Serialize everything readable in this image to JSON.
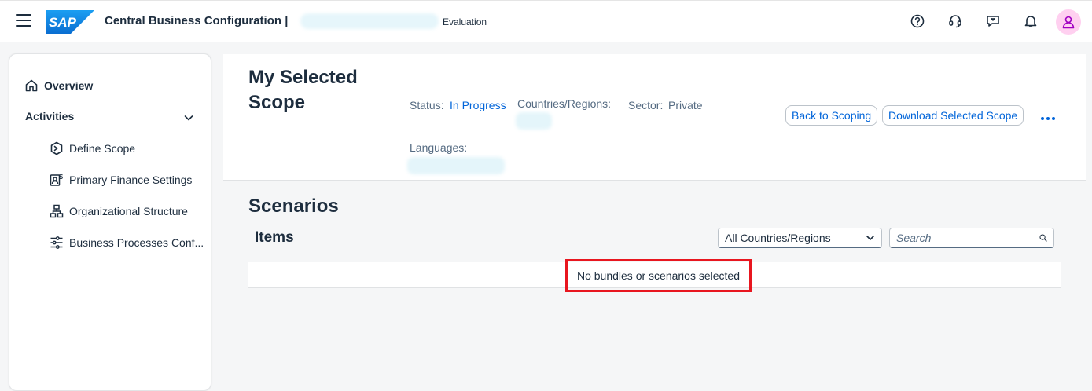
{
  "shell": {
    "brand": "SAP",
    "title": "Central Business Configuration |",
    "environment": "Evaluation",
    "icons": [
      "help-icon",
      "support-headset-icon",
      "feedback-icon",
      "notification-bell-icon",
      "user-avatar-icon"
    ]
  },
  "sidenav": {
    "overview_label": "Overview",
    "activities_label": "Activities",
    "items": [
      {
        "label": "Define Scope",
        "icon": "define-scope-icon"
      },
      {
        "label": "Primary Finance Settings",
        "icon": "finance-settings-icon"
      },
      {
        "label": "Organizational Structure",
        "icon": "org-structure-icon"
      },
      {
        "label": "Business Processes Conf...",
        "icon": "business-process-icon"
      }
    ]
  },
  "header": {
    "title": "My Selected Scope",
    "status_label": "Status:",
    "status_value": "In Progress",
    "countries_label": "Countries/Regions:",
    "sector_label": "Sector:",
    "sector_value": "Private",
    "languages_label": "Languages:",
    "back_button": "Back to Scoping",
    "download_button": "Download Selected Scope"
  },
  "content": {
    "section_title": "Scenarios",
    "items_title": "Items",
    "country_filter": "All Countries/Regions",
    "search_placeholder": "Search",
    "empty_message": "No bundles or scenarios selected"
  },
  "colors": {
    "accent": "#0064d9",
    "highlight_border": "#e8161f",
    "avatar_bg": "#ffd0f0",
    "sap_blue": "#0a6ed1"
  }
}
